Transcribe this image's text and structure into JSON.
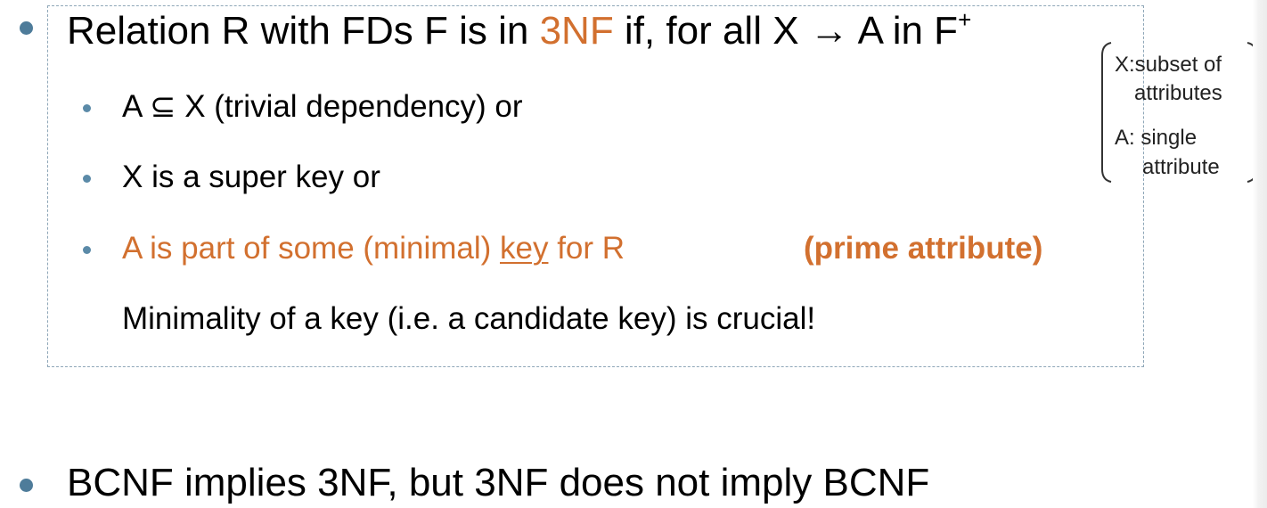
{
  "main": {
    "point1": {
      "prefix": "Relation R with FDs F is in ",
      "highlight": "3NF",
      "suffix": " if, for all X → A in F",
      "superscript": "+",
      "conditions": [
        {
          "text": "A ⊆ X  (trivial dependency) or"
        },
        {
          "text": "X is a super key or"
        },
        {
          "prefix": "A is part of some (minimal) ",
          "underlined": "key",
          "suffix": " for R",
          "note": "(prime attribute)"
        }
      ],
      "remark": "Minimality of a key (i.e. a candidate key) is crucial!"
    },
    "point2": {
      "text": "BCNF implies 3NF, but 3NF does not imply BCNF"
    }
  },
  "side_note": {
    "line1": "X:subset of",
    "line2": "attributes",
    "line3": "A: single",
    "line4": "attribute"
  },
  "colors": {
    "accent": "#d2702f",
    "bullet": "#4e7c9a",
    "box_border": "#8fa7b8"
  }
}
